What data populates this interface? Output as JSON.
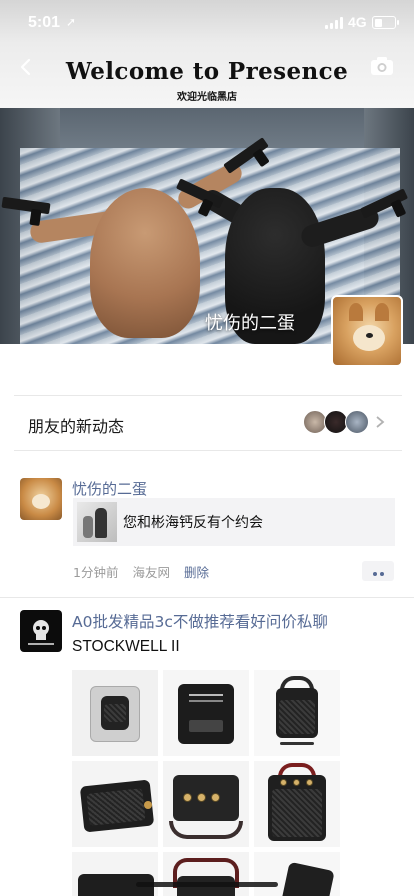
{
  "status_bar": {
    "time": "5:01",
    "network": "4G",
    "battery_level": 0.4
  },
  "cover": {
    "title": "Welcome to Presence",
    "subtitle": "欢迎光临黑店",
    "user_name": "忧伤的二蛋"
  },
  "new_activity": {
    "label": "朋友的新动态"
  },
  "feed": {
    "posts": [
      {
        "name": "忧伤的二蛋",
        "share_text": "您和彬海钙反有个约会",
        "time": "1分钟前",
        "source": "海友网",
        "delete": "删除"
      },
      {
        "name": "A0批发精品3c不做推荐看好问价私聊",
        "text": "STOCKWELL II"
      }
    ]
  },
  "colors": {
    "link": "#576b95",
    "meta": "#9b9b9b",
    "card_bg": "#f3f3f5"
  }
}
